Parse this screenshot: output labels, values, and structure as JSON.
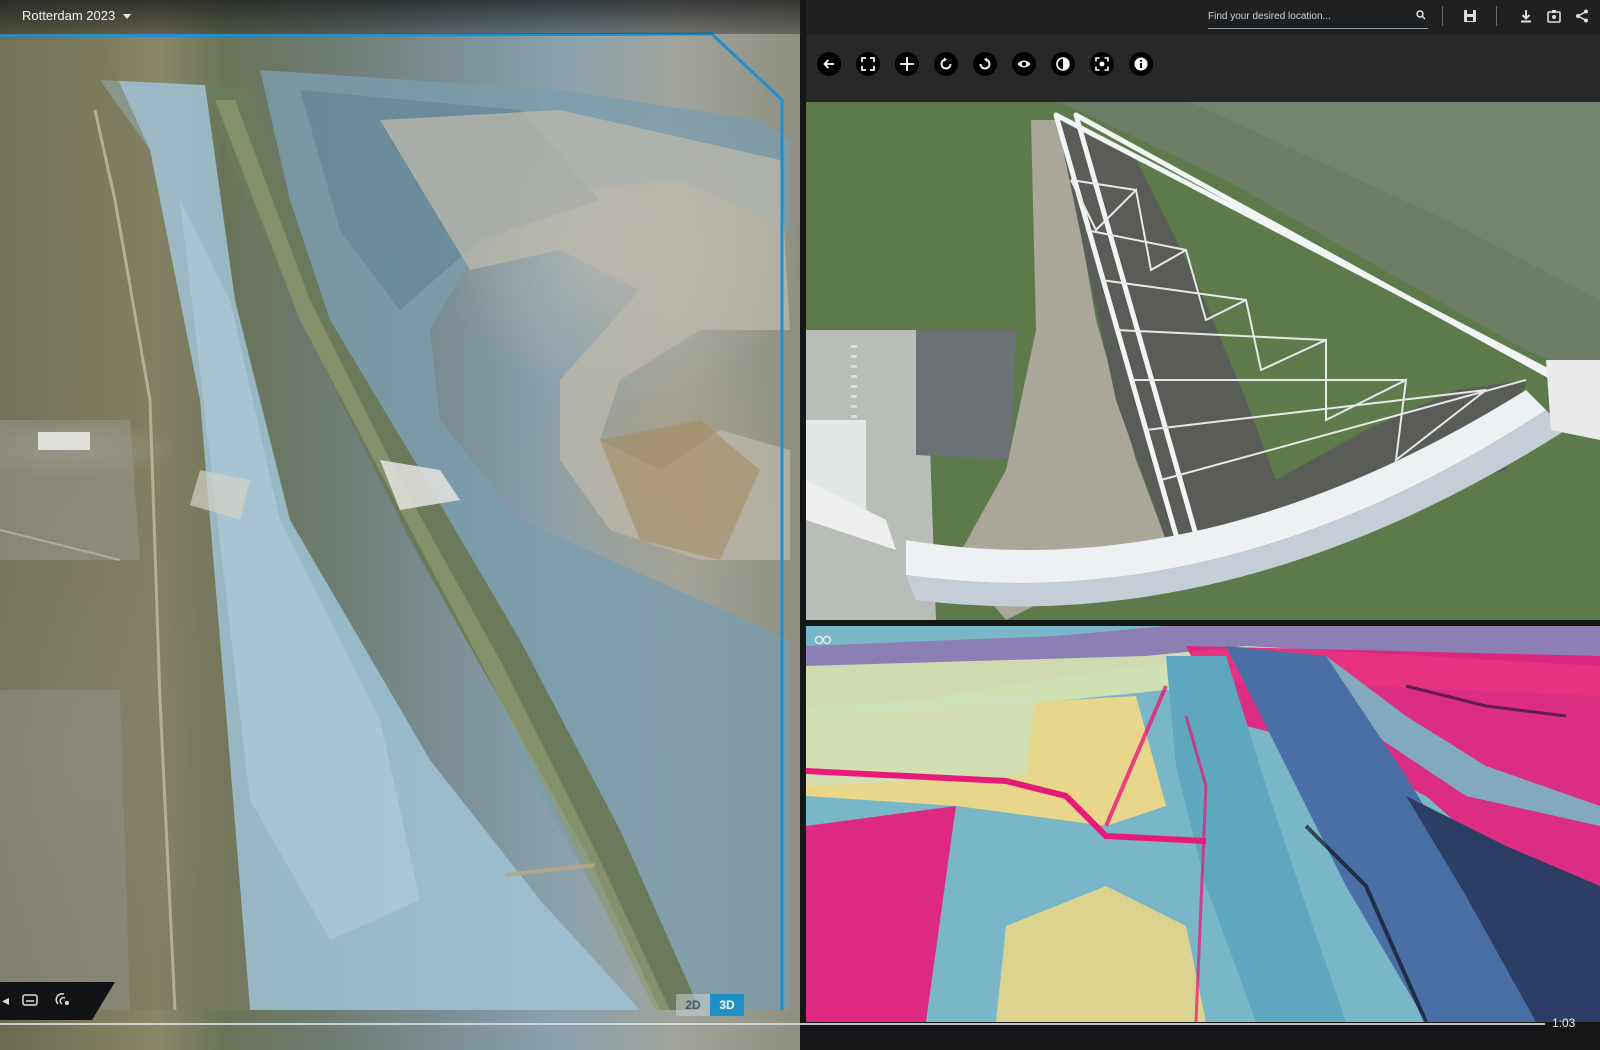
{
  "left_panel": {
    "dataset": "Rotterdam 2023",
    "view_toggle": {
      "option_2d": "2D",
      "option_3d": "3D",
      "active": "3D"
    },
    "accent_color": "#1e90c8"
  },
  "right_top": {
    "search": {
      "placeholder": "Find your desired location..."
    },
    "header_icons": [
      "save-icon",
      "download-icon",
      "screenshot-icon",
      "share-icon"
    ],
    "toolbar_icons": [
      "back-arrow-icon",
      "fullscreen-icon",
      "crosshair-icon",
      "rotate-ccw-icon",
      "rotate-cw-icon",
      "eye-icon",
      "contrast-icon",
      "focus-icon",
      "info-icon"
    ]
  },
  "right_bottom": {
    "overlay_icon": "glasses-icon",
    "palette": [
      "#e81a78",
      "#79b7c8",
      "#d8e6b0",
      "#4a6fa5",
      "#e8d68a"
    ]
  },
  "timeline": {
    "current_time": "1:03"
  }
}
